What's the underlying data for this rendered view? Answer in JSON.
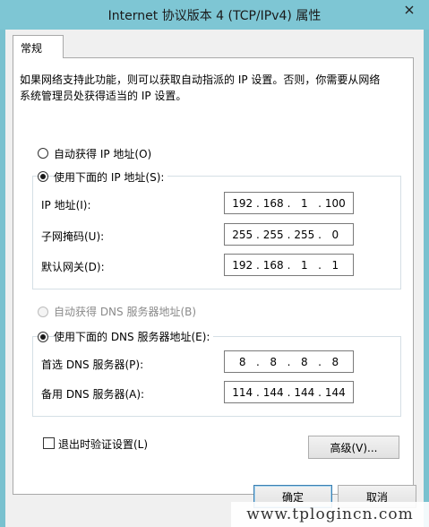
{
  "window": {
    "title": "Internet 协议版本 4 (TCP/IPv4) 属性"
  },
  "tabs": [
    {
      "label": "常规"
    }
  ],
  "description": "如果网络支持此功能，则可以获取自动指派的 IP 设置。否则，你需要从网络系统管理员处获得适当的 IP 设置。",
  "ip_mode": {
    "auto_label": "自动获得 IP 地址(O)",
    "manual_label": "使用下面的 IP 地址(S):",
    "selected": "manual"
  },
  "ip_fields": {
    "ip_address": {
      "label": "IP 地址(I):",
      "octets": [
        "192",
        "168",
        "1",
        "100"
      ]
    },
    "subnet_mask": {
      "label": "子网掩码(U):",
      "octets": [
        "255",
        "255",
        "255",
        "0"
      ]
    },
    "gateway": {
      "label": "默认网关(D):",
      "octets": [
        "192",
        "168",
        "1",
        "1"
      ]
    }
  },
  "dns_mode": {
    "auto_label": "自动获得 DNS 服务器地址(B)",
    "manual_label": "使用下面的 DNS 服务器地址(E):",
    "selected": "manual"
  },
  "dns_fields": {
    "preferred": {
      "label": "首选 DNS 服务器(P):",
      "octets": [
        "8",
        "8",
        "8",
        "8"
      ]
    },
    "alternate": {
      "label": "备用 DNS 服务器(A):",
      "octets": [
        "114",
        "144",
        "144",
        "144"
      ]
    }
  },
  "validate": {
    "label": "退出时验证设置(L)",
    "checked": false
  },
  "buttons": {
    "advanced": "高级(V)...",
    "ok": "确定",
    "cancel": "取消"
  },
  "watermark": "www.tplogincn.com",
  "colors": {
    "titlebar": "#7ec6d4",
    "frame": "#79c1cf",
    "default_button_border": "#3c7fb1"
  }
}
